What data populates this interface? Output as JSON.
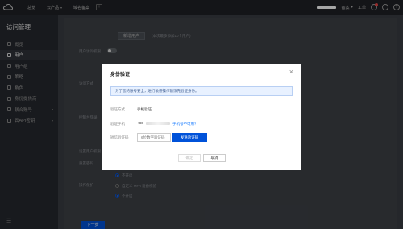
{
  "topbar": {
    "nav": [
      "总览",
      "云产品",
      "域名备案"
    ],
    "right_items": [
      "备案",
      "工单"
    ]
  },
  "sidebar": {
    "title": "访问管理",
    "items": [
      {
        "label": "概览",
        "icon": "overview-icon",
        "active": false
      },
      {
        "label": "用户",
        "icon": "user-icon",
        "active": true
      },
      {
        "label": "用户组",
        "icon": "user-group-icon",
        "active": false
      },
      {
        "label": "策略",
        "icon": "policy-icon",
        "active": false
      },
      {
        "label": "角色",
        "icon": "role-icon",
        "active": false
      },
      {
        "label": "身份提供商",
        "icon": "idp-icon",
        "active": false
      },
      {
        "label": "联合账号",
        "icon": "federation-icon",
        "active": false,
        "caret": true
      },
      {
        "label": "云API密钥",
        "icon": "api-key-icon",
        "active": false,
        "caret": true
      }
    ]
  },
  "background": {
    "add_user_button": "新增用户",
    "add_user_hint": "(本次最多添加10个用户)",
    "field_labels": [
      "用户访问权限",
      "访问方式",
      "控制台登录",
      "设置用户权限",
      "重置密码",
      "操作保护"
    ],
    "radio_labels": [
      "不开启",
      "自定义 MFA 设备校验",
      "不开启"
    ],
    "next_button": "下一步"
  },
  "modal": {
    "title": "身份验证",
    "notice": "为了您的账号安全，进行敏感操作前须先验证身份。",
    "method_label": "验证方式",
    "method_value": "手机验证",
    "phone_label": "验证手机",
    "phone_prefix": "+86",
    "phone_unavailable_link": "手机号不可用？",
    "code_label": "短信验证码",
    "code_placeholder": "6位数字验证码",
    "send_button": "发送验证码",
    "ok_button": "确定",
    "cancel_button": "取消"
  }
}
